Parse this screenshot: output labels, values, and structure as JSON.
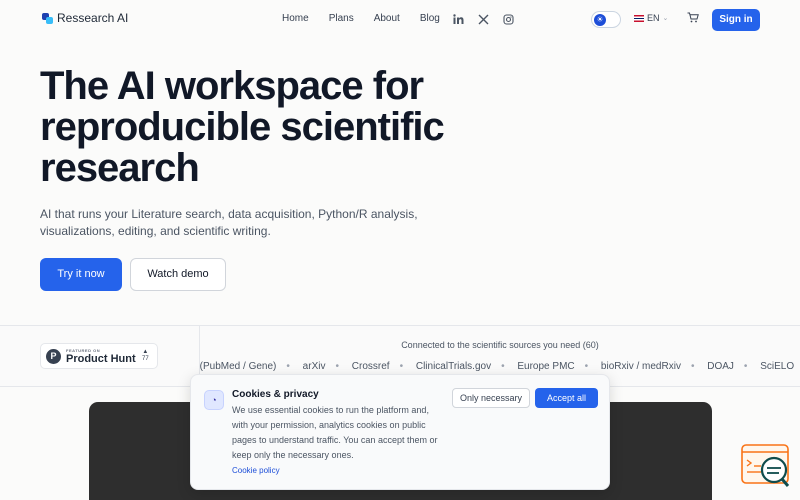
{
  "brand": {
    "name": "Ressearch AI",
    "accent": "#2563eb"
  },
  "nav": {
    "links": [
      "Home",
      "Plans",
      "About",
      "Blog"
    ],
    "social": [
      "linkedin-icon",
      "x-icon",
      "instagram-icon"
    ],
    "language": "EN",
    "signin_label": "Sign in"
  },
  "hero": {
    "title_lines": [
      "The AI workspace for",
      "reproducible scientific",
      "research"
    ],
    "subtitle": "AI that runs your Literature search, data acquisition, Python/R analysis, visualizations, editing, and scientific writing.",
    "primary_cta": "Try it now",
    "secondary_cta": "Watch demo"
  },
  "product_hunt": {
    "featured": "FEATURED ON",
    "name": "Product Hunt",
    "votes": "77"
  },
  "sources": {
    "title": "Connected to the scientific sources you need (60)",
    "items": [
      "NCBI (PubMed / Gene)",
      "arXiv",
      "Crossref",
      "ClinicalTrials.gov",
      "Europe PMC",
      "bioRxiv / medRxiv",
      "DOAJ",
      "SciELO"
    ]
  },
  "cookie": {
    "title": "Cookies & privacy",
    "text": "We use essential cookies to run the platform and, with your permission, analytics cookies on public pages to understand traffic. You can accept them or keep only the necessary ones.",
    "link": "Cookie policy",
    "necessary_label": "Only necessary",
    "accept_label": "Accept all"
  }
}
